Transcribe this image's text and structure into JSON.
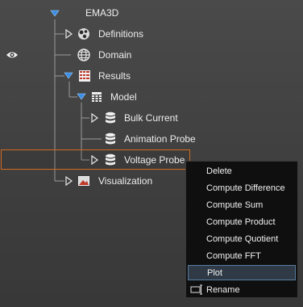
{
  "tree": {
    "root": {
      "label": "EMA3D",
      "expanded": true
    },
    "items": [
      {
        "label": "Definitions",
        "icon": "definitions-icon",
        "expanded": false
      },
      {
        "label": "Domain",
        "icon": "globe-icon"
      },
      {
        "label": "Results",
        "icon": "results-grid-icon",
        "expanded": true
      },
      {
        "label": "Model",
        "icon": "model-table-icon",
        "expanded": true
      },
      {
        "label": "Bulk Current",
        "icon": "database-icon",
        "expanded": false
      },
      {
        "label": "Animation Probe",
        "icon": "database-icon"
      },
      {
        "label": "Voltage Probe",
        "icon": "database-icon",
        "expanded": false,
        "selected": true
      },
      {
        "label": "Visualization",
        "icon": "image-icon",
        "expanded": false
      }
    ],
    "visibility_icon": "eye-icon"
  },
  "context_menu": {
    "items": [
      {
        "label": "Delete"
      },
      {
        "label": "Compute Difference"
      },
      {
        "label": "Compute Sum"
      },
      {
        "label": "Compute Product"
      },
      {
        "label": "Compute Quotient"
      },
      {
        "label": "Compute FFT"
      },
      {
        "label": "Plot",
        "highlighted": true
      },
      {
        "label": "Rename",
        "icon": "rename-icon"
      }
    ]
  },
  "colors": {
    "background": "#434343",
    "selection_border": "#d2691e",
    "expander_blue": "#3a8ee6",
    "menu_background": "#0f0f0f",
    "menu_highlight": "#2f3a46"
  }
}
